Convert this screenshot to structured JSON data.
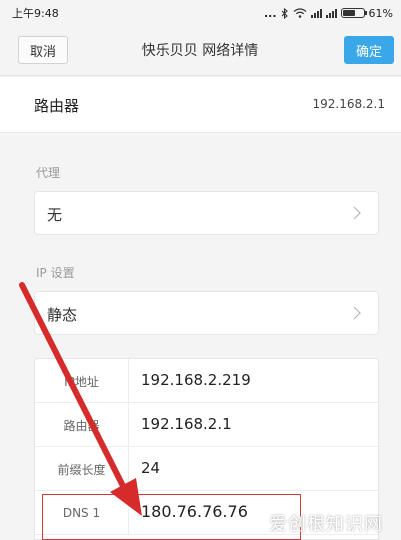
{
  "status_bar": {
    "time": "上午9:48",
    "dots": "...",
    "battery": "61%",
    "battery_level": 0.61
  },
  "nav": {
    "cancel": "取消",
    "title": "快乐贝贝  网络详情",
    "confirm": "确定"
  },
  "router_row": {
    "label": "路由器",
    "value": "192.168.2.1"
  },
  "proxy": {
    "section": "代理",
    "value": "无"
  },
  "ip_settings": {
    "section": "IP 设置",
    "value": "静态"
  },
  "ip_table": [
    {
      "key": "IP地址",
      "value": "192.168.2.219"
    },
    {
      "key": "路由器",
      "value": "192.168.2.1"
    },
    {
      "key": "前缀长度",
      "value": "24"
    },
    {
      "key": "DNS 1",
      "value": "180.76.76.76"
    }
  ],
  "watermark": "爱创根知识网",
  "icons": [
    "bluetooth-icon",
    "wifi-icon",
    "signal-icon",
    "battery-icon",
    "chevron-right-icon",
    "red-arrow"
  ]
}
